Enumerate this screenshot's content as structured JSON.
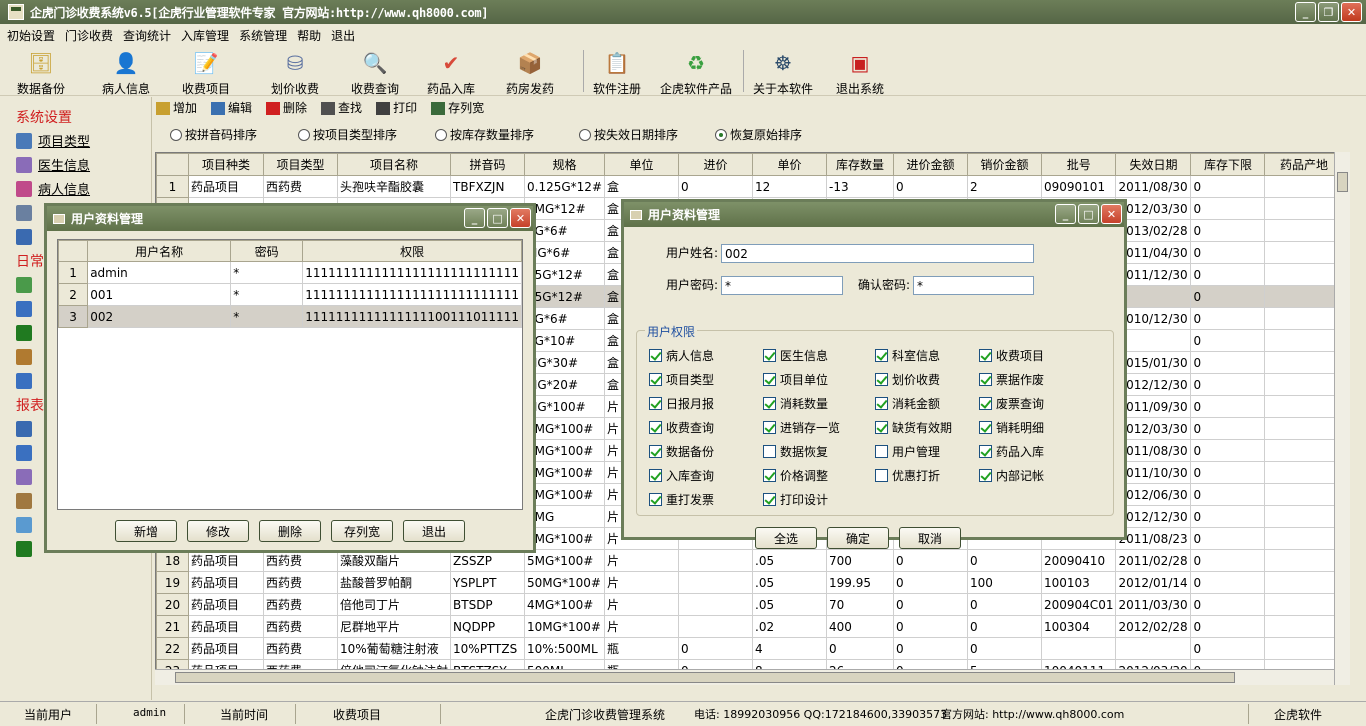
{
  "app": {
    "title": "企虎门诊收费系统v6.5[企虎行业管理软件专家 官方网站:http://www.qh8000.com]"
  },
  "menu": [
    "初始设置",
    "门诊收费",
    "查询统计",
    "入库管理",
    "系统管理",
    "帮助",
    "退出"
  ],
  "toolbar": [
    {
      "label": "数据备份",
      "icon": "database-icon"
    },
    {
      "label": "病人信息",
      "icon": "patient-icon"
    },
    {
      "label": "收费项目",
      "icon": "fee-item-icon"
    },
    {
      "label": "划价收费",
      "icon": "pricing-icon"
    },
    {
      "label": "收费查询",
      "icon": "search-icon"
    },
    {
      "label": "药品入库",
      "icon": "drug-in-icon"
    },
    {
      "label": "药房发药",
      "icon": "dispense-icon"
    },
    {
      "label": "软件注册",
      "icon": "register-icon"
    },
    {
      "label": "企虎软件产品",
      "icon": "refresh-icon"
    },
    {
      "label": "关于本软件",
      "icon": "about-icon"
    },
    {
      "label": "退出系统",
      "icon": "exit-icon"
    }
  ],
  "left_panel": {
    "section1": "系统设置",
    "items1": [
      "项目类型",
      "医生信息",
      "病人信息"
    ],
    "section2": "日常",
    "section3": "报表"
  },
  "subtoolbar": [
    "增加",
    "编辑",
    "删除",
    "查找",
    "打印",
    "存列宽"
  ],
  "sort_options": [
    "按拼音码排序",
    "按项目类型排序",
    "按库存数量排序",
    "按失效日期排序",
    "恢复原始排序"
  ],
  "sort_selected": 4,
  "grid": {
    "columns": [
      "项目种类",
      "项目类型",
      "项目名称",
      "拼音码",
      "规格",
      "单位",
      "进价",
      "单价",
      "库存数量",
      "进价金额",
      "销价金额",
      "批号",
      "失效日期",
      "库存下限",
      "药品产地"
    ],
    "rows": [
      {
        "n": "1",
        "c": [
          "药品项目",
          "西药费",
          "头孢呋辛酯胶囊",
          "TBFXZJN",
          "0.125G*12#",
          "盒",
          "0",
          "12",
          "-13",
          "0",
          "2",
          "09090101",
          "2011/08/30",
          "0",
          ""
        ]
      },
      {
        "n": "",
        "c": [
          "",
          "",
          "",
          "",
          "5MG*12#",
          "盒",
          "",
          "",
          "",
          "",
          "",
          "",
          "2012/03/30",
          "0",
          ""
        ]
      },
      {
        "n": "",
        "c": [
          "",
          "",
          "",
          "",
          "1G*6#",
          "盒",
          "",
          "",
          "",
          "",
          "",
          "",
          "2013/02/28",
          "0",
          ""
        ]
      },
      {
        "n": "",
        "c": [
          "",
          "",
          "",
          "",
          "MG*6#",
          "盒",
          "",
          "",
          "",
          "",
          "",
          "",
          "2011/04/30",
          "0",
          ""
        ]
      },
      {
        "n": "",
        "c": [
          "",
          "",
          "",
          "",
          "25G*12#",
          "盒",
          "",
          "",
          "",
          "",
          "",
          "",
          "2011/12/30",
          "0",
          ""
        ]
      },
      {
        "n": "",
        "c": [
          "",
          "",
          "",
          "",
          "25G*12#",
          "盒",
          "",
          "",
          "",
          "",
          "",
          "",
          "",
          "0",
          ""
        ]
      },
      {
        "n": "",
        "c": [
          "",
          "",
          "",
          "",
          "1G*6#",
          "盒",
          "",
          "",
          "",
          "",
          "",
          "",
          "2010/12/30",
          "0",
          ""
        ]
      },
      {
        "n": "",
        "c": [
          "",
          "",
          "",
          "",
          "1G*10#",
          "盒",
          "",
          "",
          "",
          "",
          "",
          "",
          "",
          "0",
          ""
        ]
      },
      {
        "n": "",
        "c": [
          "",
          "",
          "",
          "",
          "MG*30#",
          "盒",
          "",
          "",
          "",
          "",
          "",
          "",
          "2015/01/30",
          "0",
          ""
        ]
      },
      {
        "n": "",
        "c": [
          "",
          "",
          "",
          "",
          "MG*20#",
          "盒",
          "",
          "",
          "",
          "",
          "",
          "",
          "2012/12/30",
          "0",
          ""
        ]
      },
      {
        "n": "",
        "c": [
          "",
          "",
          "",
          "",
          "MG*100#",
          "片",
          "",
          "",
          "",
          "",
          "",
          "",
          "2011/09/30",
          "0",
          ""
        ]
      },
      {
        "n": "",
        "c": [
          "",
          "",
          "",
          "",
          "5MG*100#",
          "片",
          "",
          "",
          "",
          "",
          "",
          "",
          "2012/03/30",
          "0",
          ""
        ]
      },
      {
        "n": "",
        "c": [
          "",
          "",
          "",
          "",
          "5MG*100#",
          "片",
          "",
          "",
          "",
          "",
          "",
          "",
          "2011/08/30",
          "0",
          ""
        ]
      },
      {
        "n": "",
        "c": [
          "",
          "",
          "",
          "",
          "0MG*100#",
          "片",
          "",
          "",
          "",
          "",
          "",
          "",
          "2011/10/30",
          "0",
          ""
        ]
      },
      {
        "n": "",
        "c": [
          "",
          "",
          "",
          "",
          "5MG*100#",
          "片",
          "",
          "",
          "",
          "",
          "",
          "",
          "2012/06/30",
          "0",
          ""
        ]
      },
      {
        "n": "",
        "c": [
          "",
          "",
          "",
          "",
          "5MG",
          "片",
          "",
          "",
          "",
          "",
          "",
          "",
          "2012/12/30",
          "0",
          ""
        ]
      },
      {
        "n": "",
        "c": [
          "",
          "",
          "",
          "",
          "5MG*100#",
          "片",
          "",
          "",
          "",
          "",
          "",
          "",
          "2011/08/23",
          "0",
          ""
        ]
      },
      {
        "n": "18",
        "c": [
          "药品项目",
          "西药费",
          "藻酸双酯片",
          "ZSSZP",
          "5MG*100#",
          "片",
          "",
          ".05",
          "700",
          "0",
          "0",
          "20090410",
          "2011/02/28",
          "0",
          ""
        ]
      },
      {
        "n": "19",
        "c": [
          "药品项目",
          "西药费",
          "盐酸普罗帕酮",
          "YSPLPT",
          "50MG*100#",
          "片",
          "",
          ".05",
          "199.95",
          "0",
          "100",
          "100103",
          "2012/01/14",
          "0",
          ""
        ]
      },
      {
        "n": "20",
        "c": [
          "药品项目",
          "西药费",
          "倍他司丁片",
          "BTSDP",
          "4MG*100#",
          "片",
          "",
          ".05",
          "70",
          "0",
          "0",
          "200904C01",
          "2011/03/30",
          "0",
          ""
        ]
      },
      {
        "n": "21",
        "c": [
          "药品项目",
          "西药费",
          "尼群地平片",
          "NQDPP",
          "10MG*100#",
          "片",
          "",
          ".02",
          "400",
          "0",
          "0",
          "100304",
          "2012/02/28",
          "0",
          ""
        ]
      },
      {
        "n": "22",
        "c": [
          "药品项目",
          "西药费",
          "10%葡萄糖注射液",
          "10%PTTZS",
          "10%:500ML",
          "瓶",
          "0",
          "4",
          "0",
          "0",
          "0",
          "",
          "",
          "0",
          ""
        ]
      },
      {
        "n": "23",
        "c": [
          "药品项目",
          "西药费",
          "倍他司汀氯化钠注射",
          "BTSTZSY",
          "500ML",
          "瓶",
          "0",
          "8",
          "26",
          "0",
          "5",
          "10040111",
          "2012/03/30",
          "0",
          ""
        ]
      }
    ]
  },
  "dialog_users": {
    "title": "用户资料管理",
    "columns": [
      "用户名称",
      "密码",
      "权限"
    ],
    "rows": [
      {
        "n": "1",
        "name": "admin",
        "pwd": "*",
        "perm": "1111111111111111111111111111"
      },
      {
        "n": "2",
        "name": "001",
        "pwd": "*",
        "perm": "1111111111111111111111111111"
      },
      {
        "n": "3",
        "name": "002",
        "pwd": "*",
        "perm": "1111111111111111100111011111"
      }
    ],
    "buttons": [
      "新增",
      "修改",
      "删除",
      "存列宽",
      "退出"
    ]
  },
  "dialog_detail": {
    "title": "用户资料管理",
    "username_label": "用户姓名:",
    "username_value": "002",
    "password_label": "用户密码:",
    "password_value": "*",
    "confirm_label": "确认密码:",
    "confirm_value": "*",
    "group_label": "用户权限",
    "permissions": [
      {
        "label": "病人信息",
        "checked": true
      },
      {
        "label": "医生信息",
        "checked": true
      },
      {
        "label": "科室信息",
        "checked": true
      },
      {
        "label": "收费项目",
        "checked": true
      },
      {
        "label": "项目类型",
        "checked": true
      },
      {
        "label": "项目单位",
        "checked": true
      },
      {
        "label": "划价收费",
        "checked": true
      },
      {
        "label": "票据作废",
        "checked": true
      },
      {
        "label": "日报月报",
        "checked": true
      },
      {
        "label": "消耗数量",
        "checked": true
      },
      {
        "label": "消耗金额",
        "checked": true
      },
      {
        "label": "废票查询",
        "checked": true
      },
      {
        "label": "收费查询",
        "checked": true
      },
      {
        "label": "进销存一览",
        "checked": true
      },
      {
        "label": "缺货有效期",
        "checked": true
      },
      {
        "label": "销耗明细",
        "checked": true
      },
      {
        "label": "数据备份",
        "checked": true
      },
      {
        "label": "数据恢复",
        "checked": false
      },
      {
        "label": "用户管理",
        "checked": false
      },
      {
        "label": "药品入库",
        "checked": true
      },
      {
        "label": "入库查询",
        "checked": true
      },
      {
        "label": "价格调整",
        "checked": true
      },
      {
        "label": "优惠打折",
        "checked": false
      },
      {
        "label": "内部记帐",
        "checked": true
      },
      {
        "label": "重打发票",
        "checked": true
      },
      {
        "label": "打印设计",
        "checked": true
      }
    ],
    "buttons": [
      "全选",
      "确定",
      "取消"
    ]
  },
  "status": {
    "user_label": "当前用户",
    "user": "admin",
    "time_label": "当前时间",
    "module": "收费项目",
    "system": "企虎门诊收费管理系统",
    "contact": "电话: 18992030956 QQ:172184600,33903573",
    "website": "官方网站: http://www.qh8000.com",
    "brand": "企虎软件"
  },
  "colors": {
    "title_bar": "#5F7149",
    "accent_red": "#d02020",
    "group_label": "#2050a0"
  }
}
